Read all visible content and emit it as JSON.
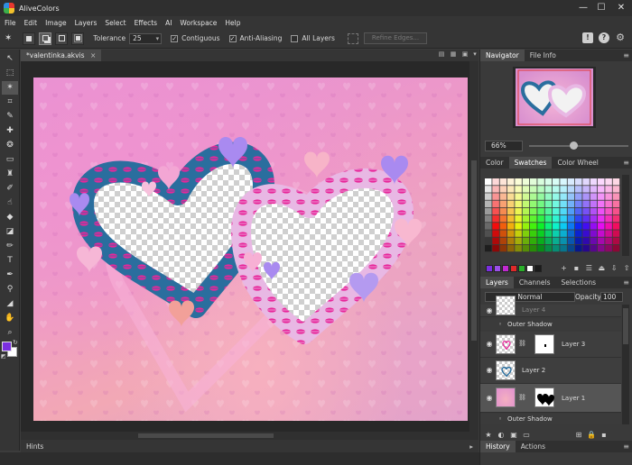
{
  "window": {
    "title": "AliveColors",
    "controls": [
      "—",
      "☐",
      "✕"
    ]
  },
  "menu": [
    "File",
    "Edit",
    "Image",
    "Layers",
    "Select",
    "Effects",
    "AI",
    "Workspace",
    "Help"
  ],
  "options": {
    "tolerance_label": "Tolerance",
    "tolerance_value": "25",
    "contiguous_label": "Contiguous",
    "contiguous_checked": true,
    "antialias_label": "Anti-Aliasing",
    "antialias_checked": true,
    "all_layers_label": "All Layers",
    "all_layers_checked": false,
    "refine_label": "Refine Edges..."
  },
  "document": {
    "tab_title": "*valentinka.akvis",
    "close_glyph": "×"
  },
  "hints": {
    "label": "Hints"
  },
  "navigator": {
    "tabs": [
      "Navigator",
      "File Info"
    ],
    "zoom": "66%"
  },
  "color_panel": {
    "tabs": [
      "Color",
      "Swatches",
      "Color Wheel"
    ],
    "active": "Swatches"
  },
  "layers_panel": {
    "tabs": [
      "Layers",
      "Channels",
      "Selections"
    ],
    "blend_mode": "Normal",
    "opacity_label": "Opacity:",
    "opacity": "100",
    "layers": [
      {
        "name": "Layer 4",
        "effect": "Outer Shadow"
      },
      {
        "name": "Layer 3",
        "effect": ""
      },
      {
        "name": "Layer 2",
        "effect": ""
      },
      {
        "name": "Layer 1",
        "effect": "Outer Shadow",
        "selected": true
      }
    ]
  },
  "bottom_tabs": [
    "History",
    "Actions"
  ],
  "colors": {
    "foreground": "#7b2fe0",
    "background": "#ffffff",
    "heart_blue": "#2a6e9e",
    "heart_pink": "#e8b8e4",
    "lip_color": "#e8269a",
    "accent_purple": "#a98af0"
  }
}
